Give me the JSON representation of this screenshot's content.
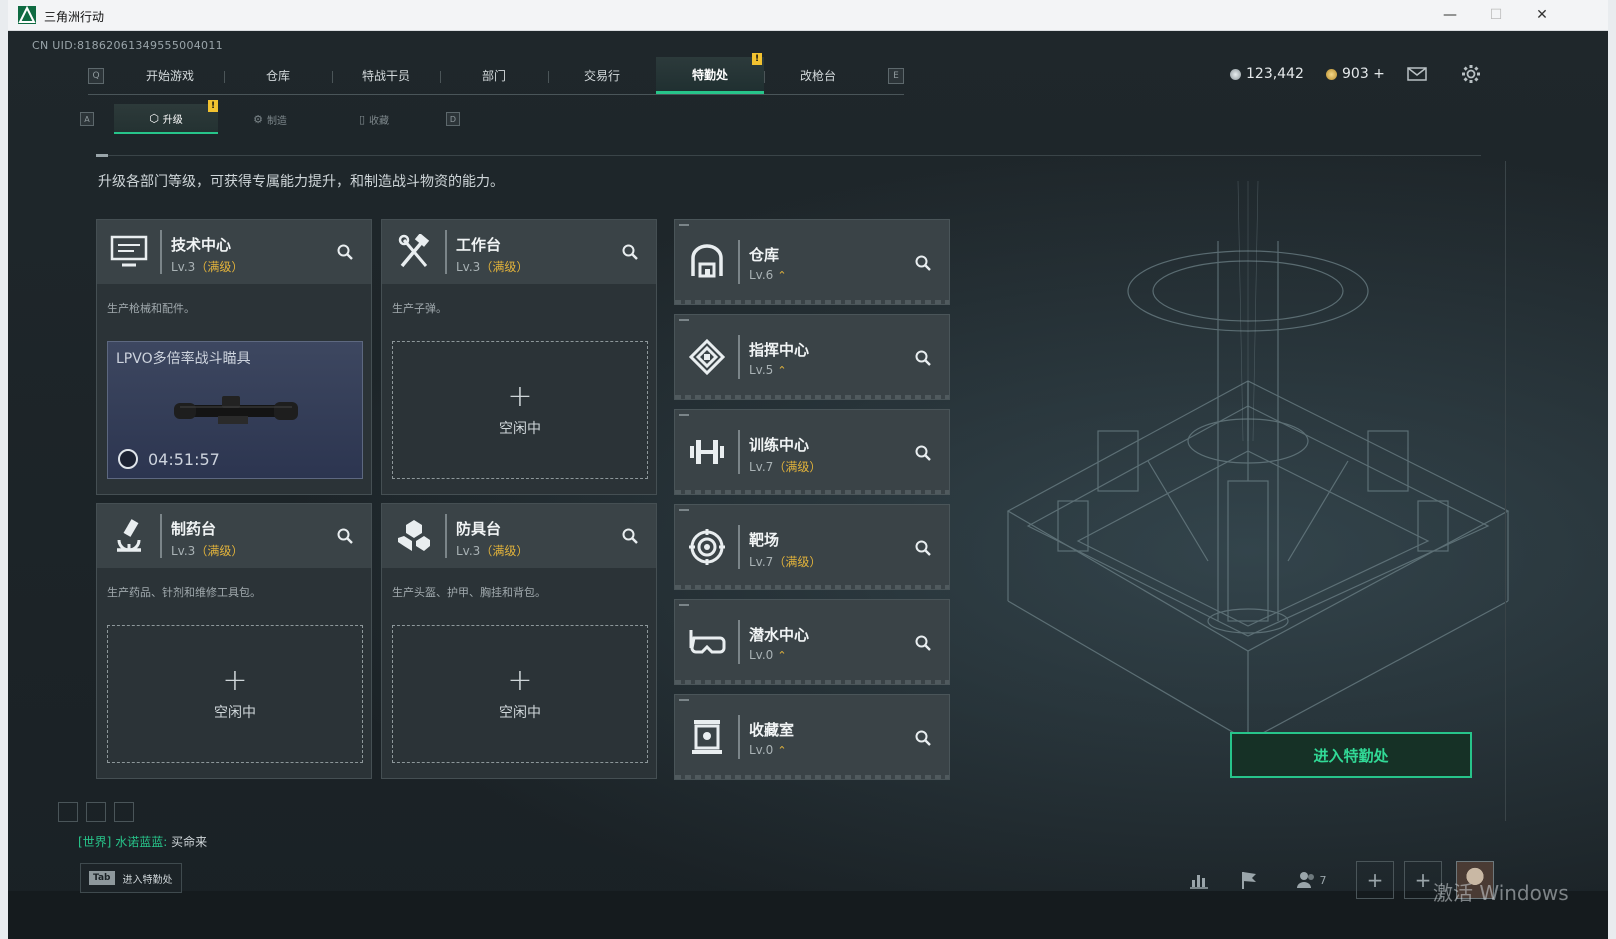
{
  "window": {
    "title": "三角洲行动"
  },
  "uid": "CN UID:8186206134955500401​1",
  "topnav": {
    "left_hint": "Q",
    "right_hint": "E",
    "tabs": [
      {
        "label": "开始游戏"
      },
      {
        "label": "仓库"
      },
      {
        "label": "特战干员"
      },
      {
        "label": "部门"
      },
      {
        "label": "交易行"
      },
      {
        "label": "特勤处",
        "active": true,
        "badge": "!"
      },
      {
        "label": "改枪台"
      }
    ]
  },
  "currency": {
    "silver": "123,442",
    "gold": "903 +"
  },
  "subnav": {
    "left_hint": "A",
    "right_hint": "D",
    "tabs": [
      {
        "label": "升级",
        "icon": "upgrade-icon",
        "active": true,
        "badge": "!"
      },
      {
        "label": "制造",
        "icon": "craft-icon"
      },
      {
        "label": "收藏",
        "icon": "collection-icon"
      }
    ]
  },
  "description": "升级各部门等级，可获得专属能力提升，和制造战斗物资的能力。",
  "workshops": [
    {
      "name": "技术中心",
      "level": "Lv.3",
      "max": "（满级）",
      "desc": "生产枪械和配件。",
      "icon": "monitor-icon",
      "crafting": {
        "item": "LPVO多倍率战斗瞄具",
        "time": "04:51:57"
      }
    },
    {
      "name": "工作台",
      "level": "Lv.3",
      "max": "（满级）",
      "desc": "生产子弹。",
      "icon": "tools-icon"
    },
    {
      "name": "制药台",
      "level": "Lv.3",
      "max": "（满级）",
      "desc": "生产药品、针剂和维修工具包。",
      "icon": "microscope-icon"
    },
    {
      "name": "防具台",
      "level": "Lv.3",
      "max": "（满级）",
      "desc": "生产头盔、护甲、胸挂和背包。",
      "icon": "armor-icon"
    }
  ],
  "slot": {
    "plus": "+",
    "idle": "空闲中"
  },
  "departments": [
    {
      "name": "仓库",
      "level": "Lv.6",
      "max": "",
      "icon": "warehouse-icon"
    },
    {
      "name": "指挥中心",
      "level": "Lv.5",
      "max": "",
      "icon": "command-icon"
    },
    {
      "name": "训练中心",
      "level": "Lv.7",
      "max": "（满级）",
      "icon": "dumbbell-icon"
    },
    {
      "name": "靶场",
      "level": "Lv.7",
      "max": "（满级）",
      "icon": "target-icon"
    },
    {
      "name": "潜水中心",
      "level": "Lv.0",
      "max": "",
      "icon": "diving-mask-icon"
    },
    {
      "name": "收藏室",
      "level": "Lv.0",
      "max": "",
      "icon": "display-case-icon"
    }
  ],
  "enter_button": "进入特勤处",
  "chat": {
    "channel": "[世界]",
    "sender": "水诺蓝蓝:",
    "message": "买命来"
  },
  "tab_hint": {
    "key": "Tab",
    "label": "进入特勤处"
  },
  "friends_count": "7",
  "watermark": "激活 Windows",
  "colors": {
    "accent": "#27c48a",
    "gold": "#e2b33b",
    "badge": "#f2c230"
  }
}
